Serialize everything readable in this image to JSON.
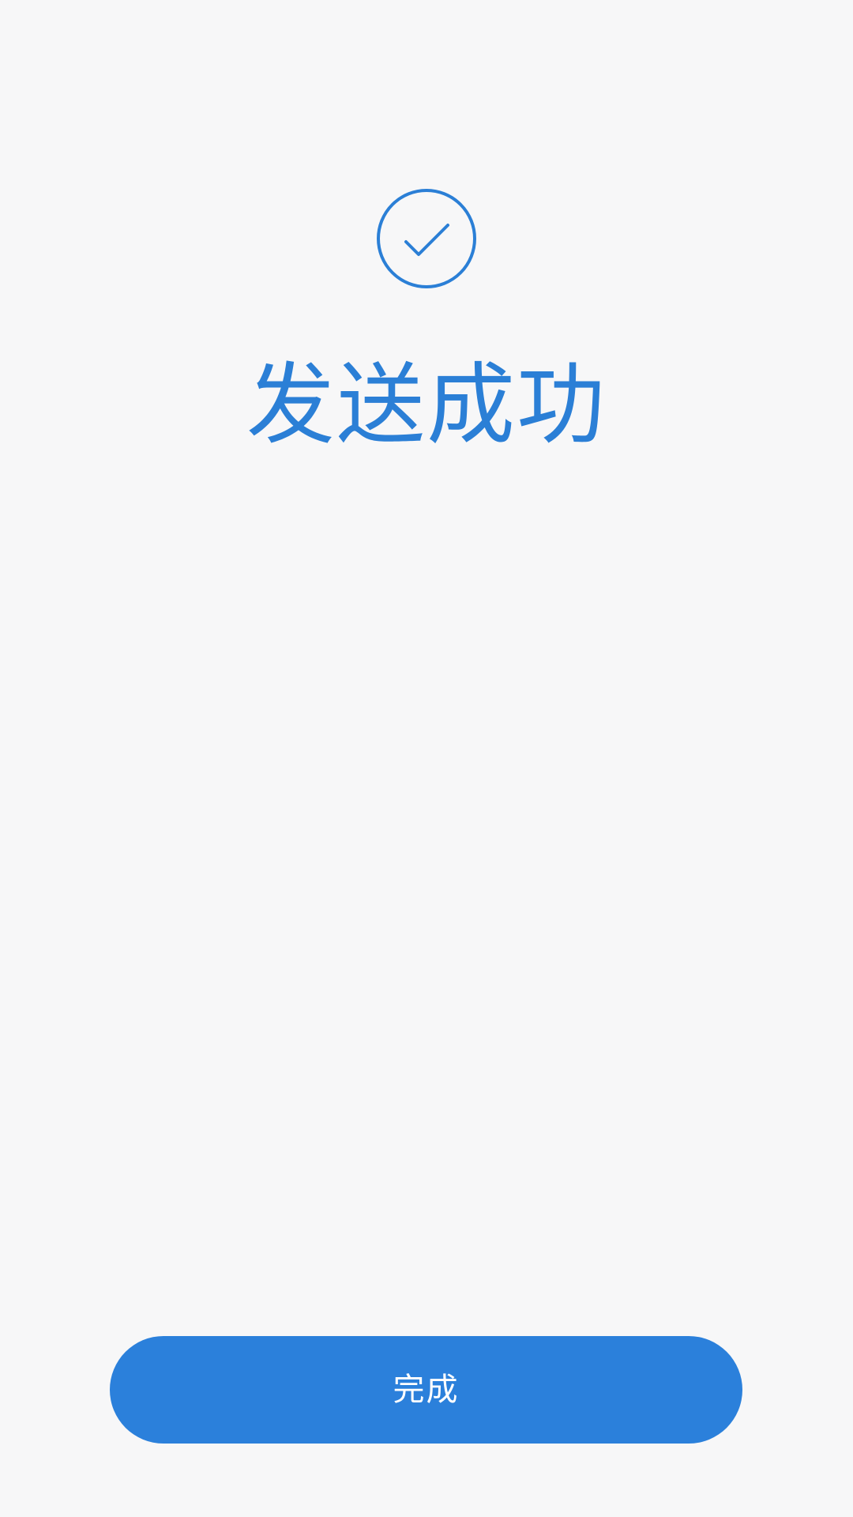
{
  "status": {
    "icon": "check-circle-icon",
    "title": "发送成功"
  },
  "actions": {
    "done_label": "完成"
  },
  "colors": {
    "accent": "#2b80db",
    "background": "#f7f7f8",
    "button_text": "#ffffff"
  }
}
